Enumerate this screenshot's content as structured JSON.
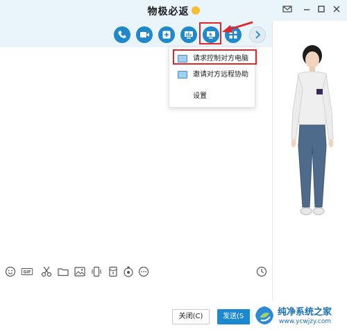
{
  "window": {
    "title": "物极必返",
    "controls": [
      "mail-icon",
      "minimize-icon",
      "maximize-icon",
      "close-icon"
    ]
  },
  "toolbar": {
    "icons": [
      "phone-icon",
      "video-icon",
      "add-chat-icon",
      "screen-share-icon",
      "remote-desktop-icon",
      "apps-icon",
      "chevron-right-icon"
    ],
    "accent": "#1f88c8"
  },
  "remote_menu": {
    "items": [
      {
        "label": "请求控制对方电脑",
        "highlighted": true
      },
      {
        "label": "邀请对方远程协助",
        "highlighted": false
      },
      {
        "label": "设置",
        "highlighted": false
      }
    ]
  },
  "input_toolbar": {
    "icons": [
      "emoji-icon",
      "gif-icon",
      "scissors-icon",
      "folder-icon",
      "image-icon",
      "shake-icon",
      "red-packet-icon",
      "voice-icon",
      "more-icon"
    ],
    "gif_label": "GIF",
    "history_icon": "clock-icon"
  },
  "buttons": {
    "close": "关闭(C)",
    "send": "发送(S"
  },
  "watermark": {
    "title": "纯净系统之家",
    "url": "www.ycwjzy.com"
  },
  "annotation_color": "#e0272c"
}
